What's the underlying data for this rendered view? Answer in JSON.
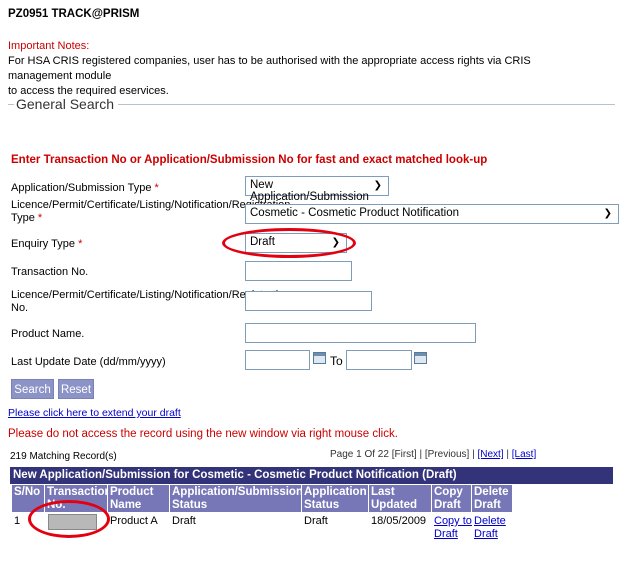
{
  "header": {
    "code_title": "PZ0951 TRACK@PRISM"
  },
  "notes": {
    "title": "Important Notes:",
    "line1": "For HSA CRIS registered companies, user has to be authorised with the appropriate access rights via CRIS management module",
    "line2": "to access the required eservices."
  },
  "general_search": {
    "legend": "General Search",
    "enter_note": "Enter Transaction No or Application/Submission No for fast and exact matched look-up",
    "app_type_label": "Application/Submission Type",
    "app_type_value": "New Application/Submission",
    "licence_type_label_1": "Licence/Permit/Certificate/Listing/Notification/Registration",
    "licence_type_label_2": "Type",
    "licence_type_value": "Cosmetic - Cosmetic Product Notification",
    "enquiry_label": "Enquiry Type",
    "enquiry_value": "Draft",
    "transaction_label": "Transaction No.",
    "licence_no_label_1": "Licence/Permit/Certificate/Listing/Notification/Registration",
    "licence_no_label_2": "No.",
    "product_label": "Product Name.",
    "last_update_label": "Last Update Date (dd/mm/yyyy)",
    "to_label": "To",
    "required_mark": "*",
    "search_button": "Search",
    "reset_button": "Reset"
  },
  "extend_link": "Please click here to extend your draft",
  "warning": "Please do not access the record using the new window via right mouse click.",
  "results": {
    "matching": "219 Matching Record(s)",
    "page_info": "Page 1 Of 22 [First] | [Previous] | ",
    "next": "[Next]",
    "sep": " | ",
    "last": "[Last]",
    "table_title": "New Application/Submission for Cosmetic - Cosmetic Product Notification (Draft)",
    "columns": [
      {
        "l1": "S/No",
        "l2": ""
      },
      {
        "l1": "Transaction",
        "l2": "No."
      },
      {
        "l1": "Product",
        "l2": "Name"
      },
      {
        "l1": "Application/Submission",
        "l2": "Status"
      },
      {
        "l1": "Application",
        "l2": "Status"
      },
      {
        "l1": "Last Updated",
        "l2": "Date"
      },
      {
        "l1": "Copy",
        "l2": "Draft"
      },
      {
        "l1": "Delete",
        "l2": "Draft"
      }
    ],
    "row": {
      "sno": "1",
      "product": "Product A",
      "sub_status": "Draft",
      "app_status": "Draft",
      "date": "18/05/2009",
      "copy_l1": "Copy to",
      "copy_l2": "Draft",
      "delete_l1": "Delete",
      "delete_l2": "Draft"
    }
  },
  "colors": {
    "table_header": "#33337a",
    "column_header": "#7777b8",
    "button": "#8c93c7",
    "highlight_oval": "#e3000f"
  }
}
